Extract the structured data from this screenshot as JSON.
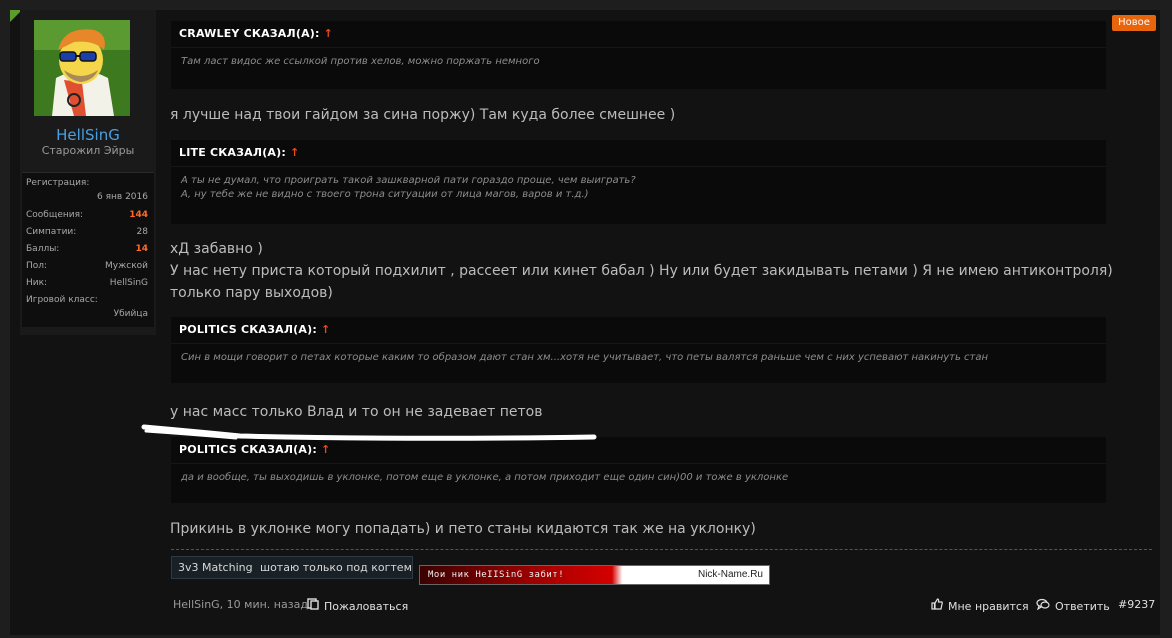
{
  "user": {
    "username": "HellSinG",
    "title": "Старожил Эйры",
    "stats": [
      {
        "label": "Регистрация:",
        "value": "6 янв 2016",
        "highlight": false,
        "below": true
      },
      {
        "label": "Сообщения:",
        "value": "144",
        "highlight": true,
        "below": false
      },
      {
        "label": "Симпатии:",
        "value": "28",
        "highlight": false,
        "below": false
      },
      {
        "label": "Баллы:",
        "value": "14",
        "highlight": true,
        "below": false
      },
      {
        "label": "Пол:",
        "value": "Мужской",
        "highlight": false,
        "below": false
      },
      {
        "label": "Ник:",
        "value": "HellSinG",
        "highlight": false,
        "below": false
      },
      {
        "label": "Игровой класс:",
        "value": "Убийца",
        "highlight": false,
        "below": true
      }
    ]
  },
  "badge": "Новое",
  "quotes": [
    {
      "author": "CRAWLEY СКАЗАЛ(А):",
      "arrow": "↑",
      "lines": [
        "Там ласт видос же ссылкой против хелов, можно поржать немного"
      ]
    },
    {
      "author": "LITE СКАЗАЛ(А):",
      "arrow": "↑",
      "lines": [
        "А ты не думал, что проиграть такой зашкварной пати гораздо проще, чем выиграть?",
        "А, ну тебе же не видно с твоего трона ситуации от лица магов, варов и т.д.)"
      ]
    },
    {
      "author": "POLITICS СКАЗАЛ(А):",
      "arrow": "↑",
      "lines": [
        "Син в мощи говорит о петах которые каким то образом дают стан хм...хотя не учитывает, что петы валятся раньше чем с них успевают накинуть стан"
      ]
    },
    {
      "author": "POLITICS СКАЗАЛ(А):",
      "arrow": "↑",
      "lines": [
        "да и вообще, ты выходишь в уклонке, потом еще в уклонке, а потом приходит еще один син)00 и тоже в уклонке"
      ]
    }
  ],
  "messages": [
    {
      "lines": [
        "я лучше над твои гайдом за сина поржу) Там куда более смешнее )"
      ]
    },
    {
      "lines": [
        "хД забавно )",
        "У нас нету приста который подхилит , рассеет или кинет бабал ) Ну или будет закидывать петами ) Я не имею антиконтроля)",
        "только пару выходов)"
      ]
    },
    {
      "lines": [
        "у нас масс только Влад и то он не задевает петов"
      ]
    },
    {
      "lines": [
        "Прикинь в уклонке могу попадать) и пето станы кидаются так же на уклонку)"
      ]
    }
  ],
  "signature": {
    "banner1_left": "3v3 Matching",
    "banner1_right": "шотаю только под когтем",
    "banner2_left": "Мои ник HeIISinG забит!",
    "banner2_right": "Nick-Name.Ru"
  },
  "footer": {
    "meta": "HellSinG, 10 мин. назад",
    "report": "Пожаловаться",
    "like": "Мне нравится",
    "reply": "Ответить",
    "post_number": "#9237"
  },
  "colors": {
    "accent_orange": "#e8650c",
    "username_blue": "#4a9fe0",
    "quote_arrow": "#e84a1a"
  },
  "icons": [
    "report-icon",
    "thumbs-up-icon",
    "reply-icon"
  ]
}
